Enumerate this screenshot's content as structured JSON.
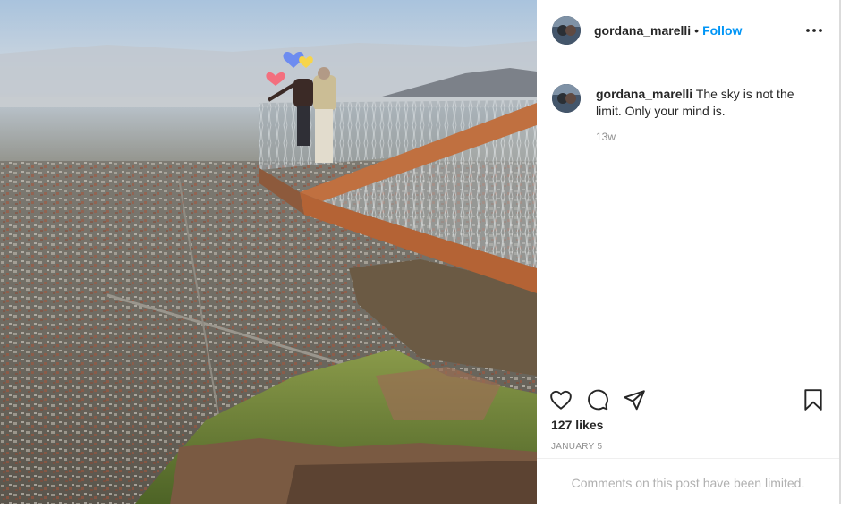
{
  "post": {
    "username": "gordana_marelli",
    "separator": "•",
    "follow_label": "Follow",
    "caption": "The sky is not the limit. Only your mind is.",
    "time_ago": "13w",
    "likes": "127 likes",
    "date": "JANUARY 5",
    "comments_limited": "Comments on this post have been limited."
  },
  "icons": {
    "more": "more-options-icon",
    "like": "heart-icon",
    "comment": "comment-icon",
    "share": "share-icon",
    "save": "bookmark-icon"
  }
}
